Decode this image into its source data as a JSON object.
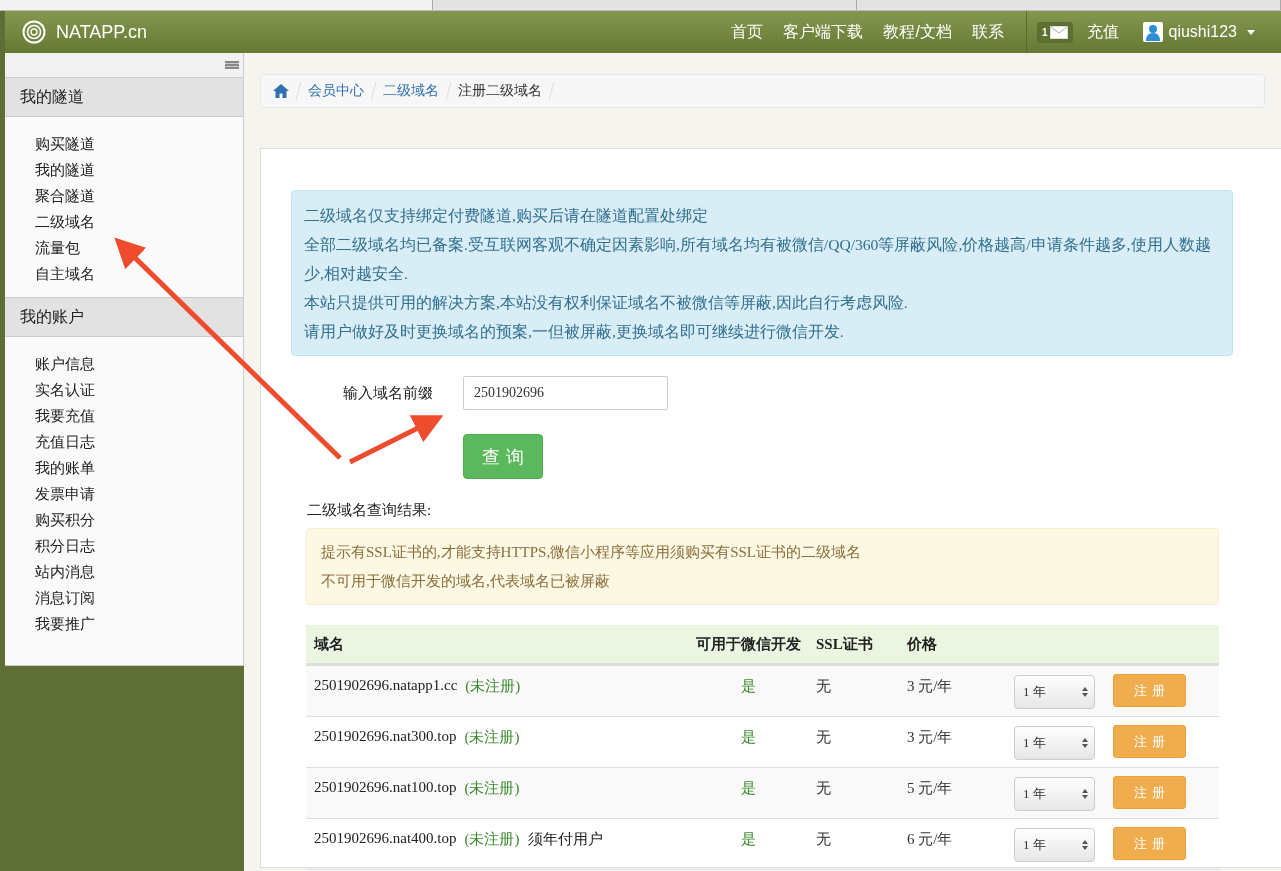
{
  "browser_tabs": [
    {
      "selected": true
    },
    {
      "selected": false
    },
    {
      "selected": false
    }
  ],
  "navbar": {
    "brand": "NATAPP.cn",
    "links": [
      "首页",
      "客户端下载",
      "教程/文档",
      "联系"
    ],
    "message_count": "1",
    "recharge": "充值",
    "user": "qiushi123"
  },
  "sidebar": {
    "sections": [
      {
        "title": "我的隧道",
        "items": [
          "购买隧道",
          "我的隧道",
          "聚合隧道",
          "二级域名",
          "流量包",
          "自主域名"
        ]
      },
      {
        "title": "我的账户",
        "items": [
          "账户信息",
          "实名认证",
          "我要充值",
          "充值日志",
          "我的账单",
          "发票申请",
          "购买积分",
          "积分日志",
          "站内消息",
          "消息订阅",
          "我要推广"
        ]
      }
    ]
  },
  "breadcrumb": [
    {
      "label": "会员中心",
      "kind": "link"
    },
    {
      "label": "二级域名",
      "kind": "link"
    },
    {
      "label": "注册二级域名",
      "kind": "current"
    }
  ],
  "notice": [
    "二级域名仅支持绑定付费隧道,购买后请在隧道配置处绑定",
    "全部二级域名均已备案.受互联网客观不确定因素影响,所有域名均有被微信/QQ/360等屏蔽风险,价格越高/申请条件越多,使用人数越少,相对越安全.",
    "本站只提供可用的解决方案,本站没有权利保证域名不被微信等屏蔽,因此自行考虑风险.",
    "请用户做好及时更换域名的预案,一但被屏蔽,更换域名即可继续进行微信开发."
  ],
  "form": {
    "label": "输入域名前缀",
    "value": "2501902696",
    "button": "查 询"
  },
  "results_title": "二级域名查询结果:",
  "tips": [
    "提示有SSL证书的,才能支持HTTPS,微信小程序等应用须购买有SSL证书的二级域名",
    "不可用于微信开发的域名,代表域名已被屏蔽"
  ],
  "table": {
    "columns": [
      "域名",
      "可用于微信开发",
      "SSL证书",
      "价格"
    ],
    "rows": [
      {
        "domain": "2501902696.natapp1.cc",
        "status": "(未注册)",
        "wechat": "是",
        "ssl": "无",
        "price": "3 元/年",
        "period": "1 年",
        "action": "注 册"
      },
      {
        "domain": "2501902696.nat300.top",
        "status": "(未注册)",
        "wechat": "是",
        "ssl": "无",
        "price": "3 元/年",
        "period": "1 年",
        "action": "注 册"
      },
      {
        "domain": "2501902696.nat100.top",
        "status": "(未注册)",
        "wechat": "是",
        "ssl": "无",
        "price": "5 元/年",
        "period": "1 年",
        "action": "注 册"
      },
      {
        "domain": "2501902696.nat400.top",
        "status": "(未注册)",
        "note": "须年付用户",
        "wechat": "是",
        "ssl": "无",
        "price": "6 元/年",
        "period": "1 年",
        "action": "注 册"
      }
    ]
  }
}
